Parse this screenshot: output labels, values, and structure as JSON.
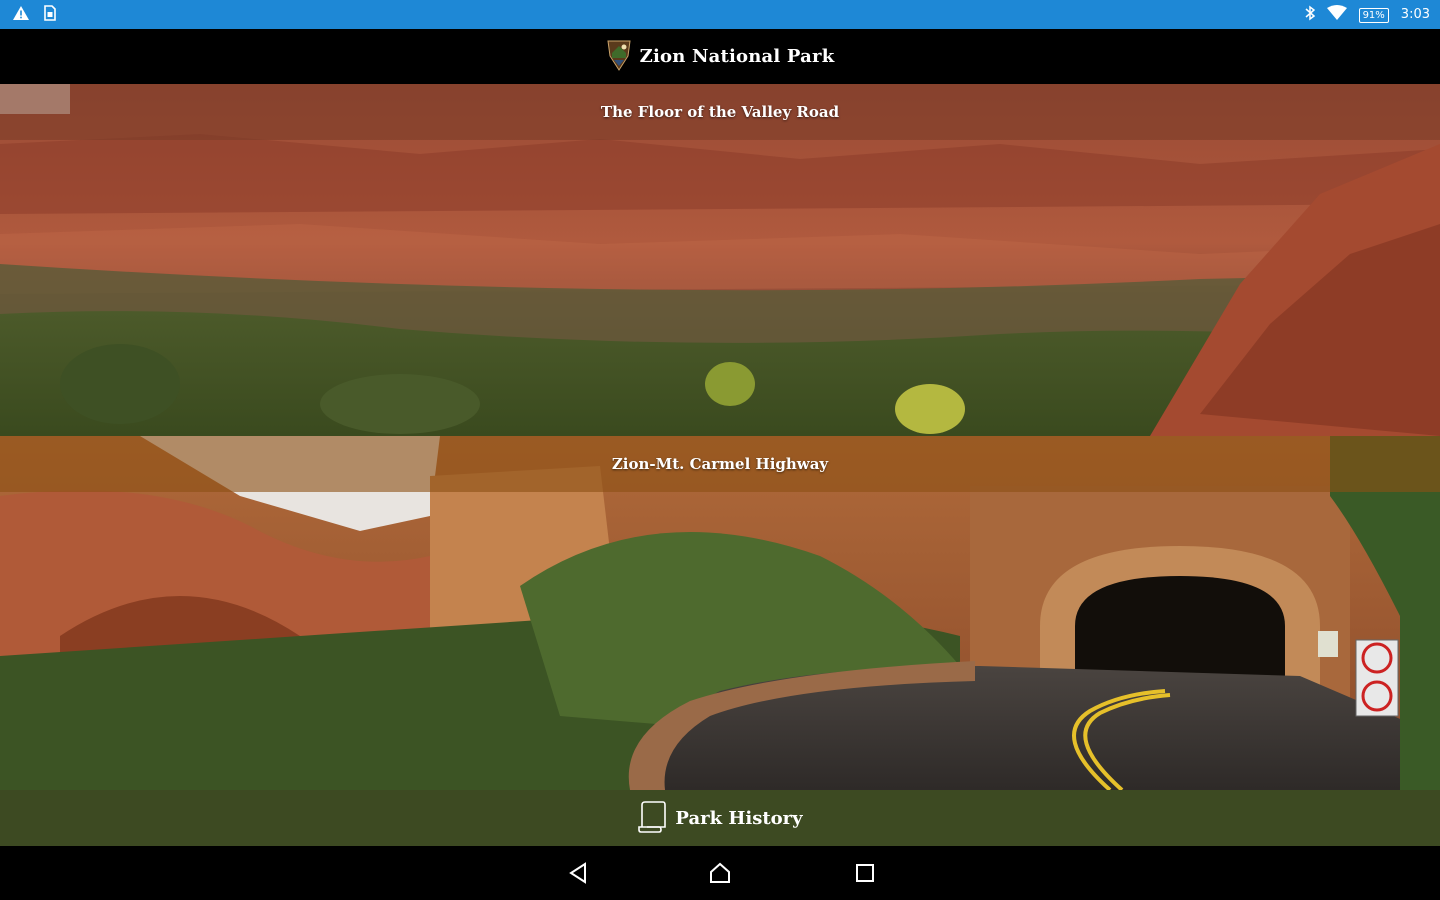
{
  "status_bar": {
    "left_icons": [
      "warning-icon",
      "sim-card-icon"
    ],
    "right_icons": [
      "bluetooth-icon",
      "wifi-icon",
      "battery-icon"
    ],
    "battery": "91%",
    "time": "3:03"
  },
  "app_bar": {
    "logo_icon": "nps-arrowhead-icon",
    "title": "Zion National Park"
  },
  "panels": [
    {
      "label": "The Floor of the Valley Road"
    },
    {
      "label": "Zion-Mt. Carmel Highway"
    }
  ],
  "history": {
    "icon": "scroll-icon",
    "label": "Park History"
  },
  "nav_bar": {
    "buttons": [
      "back-icon",
      "home-icon",
      "recents-icon"
    ]
  },
  "colors": {
    "status_bar": "#1e88d6",
    "history_bar": "#3d4a22"
  }
}
